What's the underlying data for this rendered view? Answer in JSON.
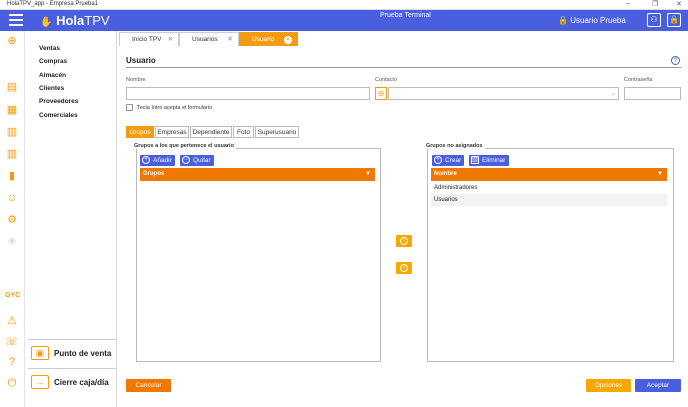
{
  "window": {
    "title": "HolaTPV_app - Empresa Prueba1"
  },
  "appbar": {
    "brand_bold": "Hola",
    "brand_light": "TPV",
    "title": "Prueba Terminal",
    "user": "Usuario Prueba"
  },
  "menu": {
    "items": [
      "Ventas",
      "Compras",
      "Almacén",
      "Clientes",
      "Proveedores",
      "Comerciales"
    ],
    "gyc": "GYC"
  },
  "bottom_buttons": {
    "pos": "Punto de venta",
    "close": "Cierre caja/día"
  },
  "tabs": [
    "Inicio TPV",
    "Usuarios",
    "Usuario"
  ],
  "form": {
    "section_title": "Usuario",
    "nombre_label": "Nombre",
    "nombre_value": "",
    "contacto_label": "Contacto",
    "contacto_value": "",
    "contrasena_label": "Contraseña",
    "contrasena_value": "",
    "enter_checkbox_label": "Tecla Intro acepta el formulario"
  },
  "subtabs": [
    "Grupos",
    "Empresas",
    "Dependiente",
    "Foto",
    "Superusuario"
  ],
  "assigned": {
    "title": "Grupos a los que pertenece el usuario",
    "add": "Añadir",
    "remove": "Quitar",
    "header": "Grupos",
    "rows": []
  },
  "unassigned": {
    "title": "Grupos no asignados",
    "create": "Crear",
    "delete": "Eliminar",
    "header": "Nombre",
    "rows": [
      "Administradores",
      "Usuarios"
    ]
  },
  "footer": {
    "cancel": "Cancelar",
    "options": "Opciones",
    "accept": "Aceptar"
  },
  "colors": {
    "primary": "#4a5fe0",
    "accent": "#f39c12",
    "header": "#f07800"
  }
}
